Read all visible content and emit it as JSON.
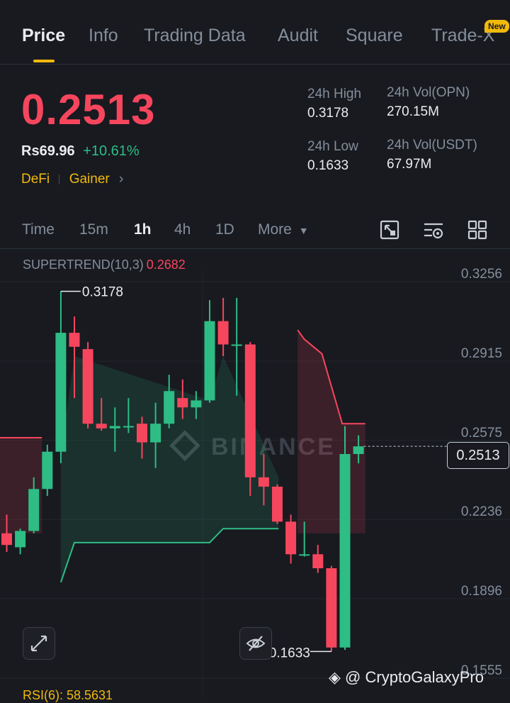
{
  "tabs": [
    {
      "label": "Price",
      "active": true
    },
    {
      "label": "Info"
    },
    {
      "label": "Trading Data"
    },
    {
      "label": "Audit"
    },
    {
      "label": "Square"
    },
    {
      "label": "Trade-X"
    }
  ],
  "new_badge": "New",
  "ticker": {
    "price": "0.2513",
    "fiat": "Rs69.96",
    "change": "+10.61%",
    "tag_category": "DeFi",
    "tag_gainer": "Gainer"
  },
  "stats": {
    "high_label": "24h High",
    "high_value": "0.3178",
    "low_label": "24h Low",
    "low_value": "0.1633",
    "vol_opn_label": "24h Vol(OPN)",
    "vol_opn_value": "270.15M",
    "vol_usdt_label": "24h Vol(USDT)",
    "vol_usdt_value": "67.97M"
  },
  "intervals": [
    "Time",
    "15m",
    "1h",
    "4h",
    "1D",
    "More"
  ],
  "active_interval": "1h",
  "indicator": {
    "name": "SUPERTREND(10,3)",
    "value": "0.2682"
  },
  "colors": {
    "up": "#2ebd85",
    "down": "#f6465d",
    "accent": "#f0b90b",
    "bg": "#181a20"
  },
  "chart_data": {
    "type": "candlestick",
    "y_ticks": [
      "0.3256",
      "0.2915",
      "0.2575",
      "0.2236",
      "0.1896",
      "0.1555"
    ],
    "ylim": [
      0.1555,
      0.3256
    ],
    "current_price": "0.2513",
    "high_label": "0.3178",
    "low_label": "0.1633",
    "watermark": "BINANCE",
    "candles": [
      {
        "o": 0.214,
        "h": 0.222,
        "l": 0.206,
        "c": 0.209
      },
      {
        "o": 0.208,
        "h": 0.216,
        "l": 0.205,
        "c": 0.215
      },
      {
        "o": 0.215,
        "h": 0.238,
        "l": 0.214,
        "c": 0.233
      },
      {
        "o": 0.233,
        "h": 0.252,
        "l": 0.23,
        "c": 0.249
      },
      {
        "o": 0.249,
        "h": 0.3178,
        "l": 0.244,
        "c": 0.3
      },
      {
        "o": 0.3,
        "h": 0.307,
        "l": 0.272,
        "c": 0.294
      },
      {
        "o": 0.293,
        "h": 0.296,
        "l": 0.259,
        "c": 0.261
      },
      {
        "o": 0.261,
        "h": 0.272,
        "l": 0.258,
        "c": 0.259
      },
      {
        "o": 0.259,
        "h": 0.268,
        "l": 0.249,
        "c": 0.26
      },
      {
        "o": 0.26,
        "h": 0.272,
        "l": 0.257,
        "c": 0.26
      },
      {
        "o": 0.261,
        "h": 0.264,
        "l": 0.246,
        "c": 0.253
      },
      {
        "o": 0.253,
        "h": 0.27,
        "l": 0.242,
        "c": 0.261
      },
      {
        "o": 0.261,
        "h": 0.282,
        "l": 0.259,
        "c": 0.275
      },
      {
        "o": 0.272,
        "h": 0.28,
        "l": 0.263,
        "c": 0.268
      },
      {
        "o": 0.268,
        "h": 0.275,
        "l": 0.263,
        "c": 0.271
      },
      {
        "o": 0.271,
        "h": 0.314,
        "l": 0.27,
        "c": 0.305
      },
      {
        "o": 0.305,
        "h": 0.315,
        "l": 0.29,
        "c": 0.295
      },
      {
        "o": 0.295,
        "h": 0.315,
        "l": 0.273,
        "c": 0.295
      },
      {
        "o": 0.295,
        "h": 0.296,
        "l": 0.23,
        "c": 0.238
      },
      {
        "o": 0.238,
        "h": 0.248,
        "l": 0.226,
        "c": 0.234
      },
      {
        "o": 0.234,
        "h": 0.235,
        "l": 0.218,
        "c": 0.219
      },
      {
        "o": 0.219,
        "h": 0.222,
        "l": 0.201,
        "c": 0.205
      },
      {
        "o": 0.205,
        "h": 0.219,
        "l": 0.204,
        "c": 0.205
      },
      {
        "o": 0.205,
        "h": 0.209,
        "l": 0.197,
        "c": 0.199
      },
      {
        "o": 0.199,
        "h": 0.2,
        "l": 0.1633,
        "c": 0.165
      },
      {
        "o": 0.165,
        "h": 0.26,
        "l": 0.164,
        "c": 0.248
      },
      {
        "o": 0.248,
        "h": 0.256,
        "l": 0.244,
        "c": 0.2513
      }
    ],
    "supertrend_down": [
      {
        "i": -0.6,
        "v": 0.255
      },
      {
        "i": 2.6,
        "v": 0.255
      },
      {
        "i": 21.5,
        "v": 0.3012
      },
      {
        "i": 22.0,
        "v": 0.2972
      },
      {
        "i": 23.3,
        "v": 0.291
      },
      {
        "i": 24.8,
        "v": 0.261
      },
      {
        "i": 26.5,
        "v": 0.261
      }
    ],
    "supertrend_up": [
      {
        "i": 4.0,
        "v": 0.193
      },
      {
        "i": 5.0,
        "v": 0.21
      },
      {
        "i": 15.0,
        "v": 0.21
      },
      {
        "i": 16.0,
        "v": 0.216
      },
      {
        "i": 20.1,
        "v": 0.216
      }
    ]
  },
  "credit": "@ CryptoGalaxyPro",
  "rsi_label": "RSI(6): 58.5631"
}
